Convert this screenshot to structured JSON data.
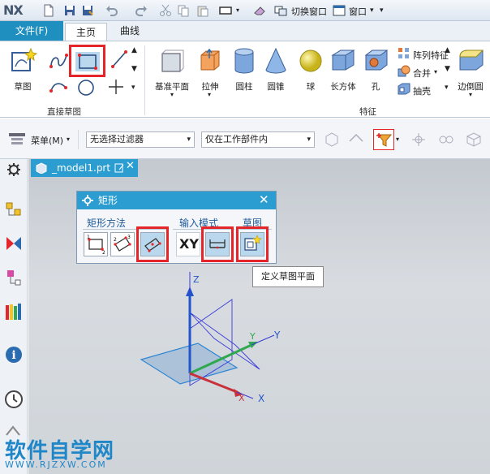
{
  "titlebar": {
    "logo": "NX",
    "switch_window": "切换窗口",
    "window_menu": "窗口"
  },
  "ribbon_tabs": {
    "file": "文件(F)",
    "home": "主页",
    "curve": "曲线"
  },
  "ribbon": {
    "sketch": "草图",
    "direct_sketch_group": "直接草图",
    "datum_plane": "基准平面",
    "extrude": "拉伸",
    "cylinder": "圆柱",
    "cone": "圆锥",
    "sphere": "球",
    "block": "长方体",
    "hole": "孔",
    "pattern_feature": "阵列特征",
    "unite": "合并",
    "shell": "抽壳",
    "edge_blend": "边倒圆",
    "feature_group": "特征"
  },
  "selection_bar": {
    "menu": "菜单(M)",
    "filter": "无选择过滤器",
    "scope": "仅在工作部件内"
  },
  "document_tab": {
    "name": "_model1.prt"
  },
  "dialog": {
    "title": "矩形",
    "method_group": "矩形方法",
    "input_mode_group": "输入模式",
    "sketch_group": "草图",
    "xy_label": "XY"
  },
  "tooltip": "定义草图平面",
  "axes": {
    "z": "Z",
    "y_line": "Y",
    "y_csys": "Y",
    "x_line": "X",
    "x_csys": "X"
  },
  "watermark": {
    "cn": "软件自学网",
    "en": "WWW.RJZXW.COM"
  },
  "colors": {
    "accent": "#1f8fc0",
    "highlight": "#e4262a"
  }
}
